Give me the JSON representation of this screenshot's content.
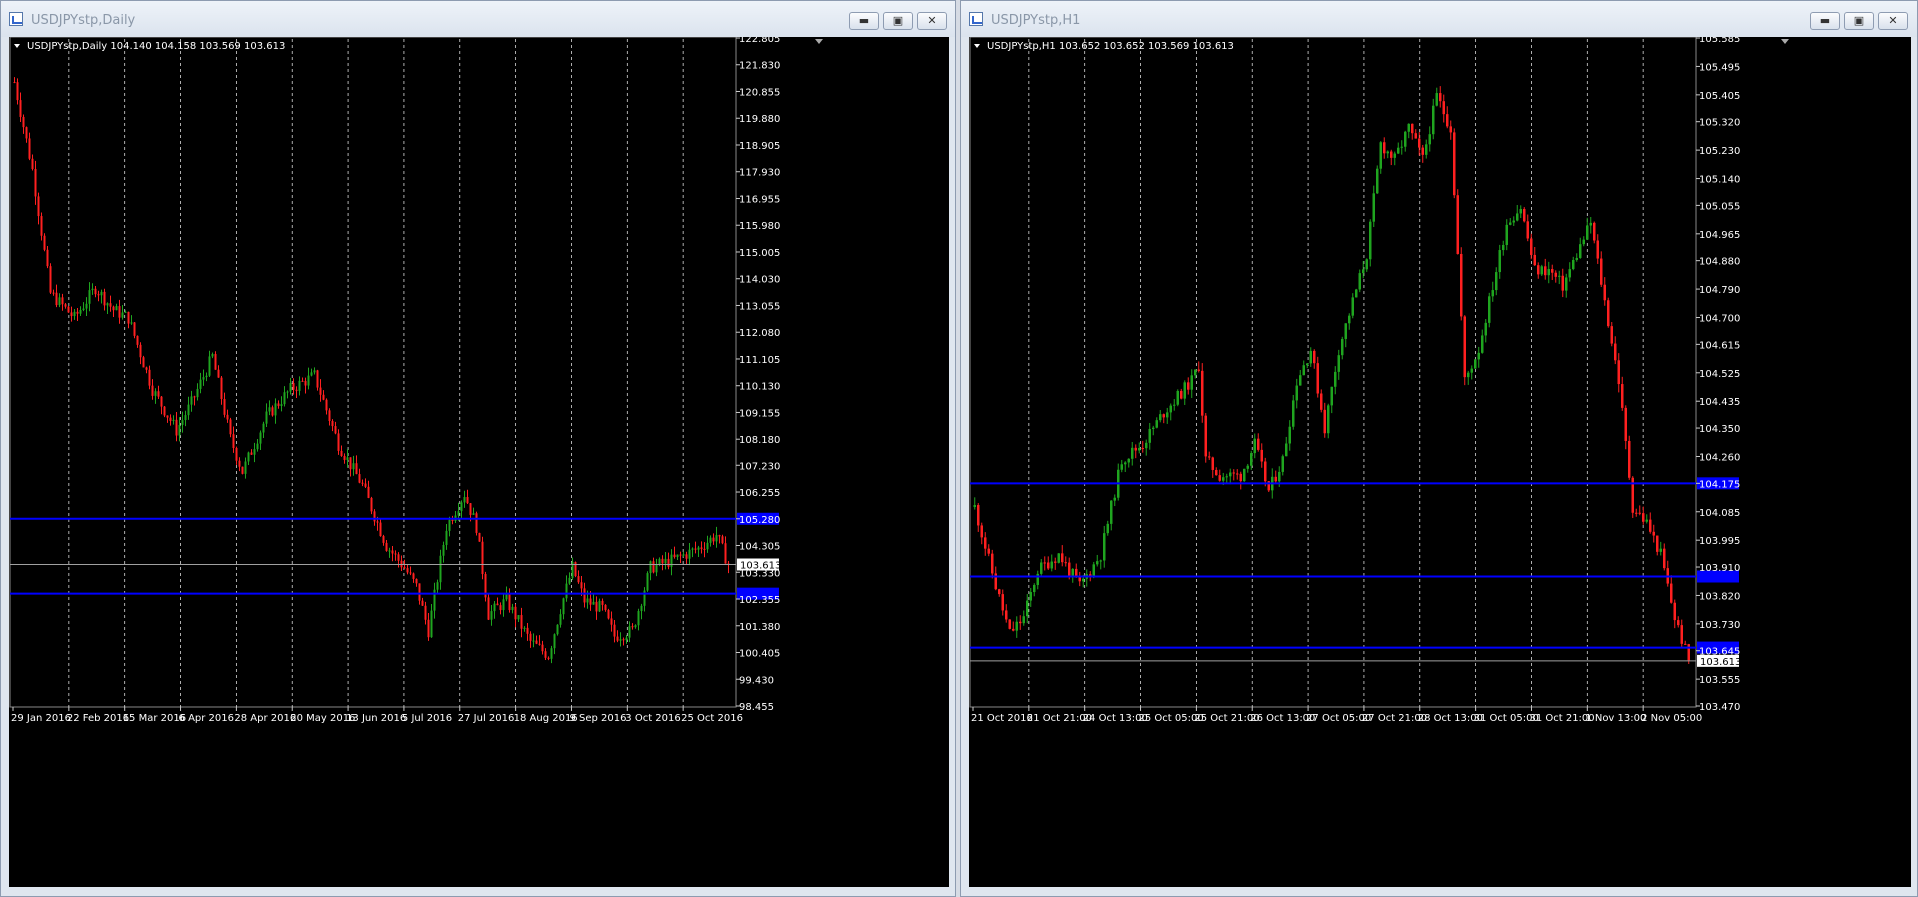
{
  "windows": [
    {
      "title": "USDJPYstp,Daily",
      "header": "USDJPYstp,Daily  104.140 104.158 103.569 103.613",
      "current_price": "103.613"
    },
    {
      "title": "USDJPYstp,H1",
      "header": "USDJPYstp,H1  103.652 103.652 103.569 103.613",
      "current_price": "103.613"
    }
  ],
  "colors": {
    "background": "#000000",
    "grid": "#ffffff",
    "bull_candle": "#1fa51f",
    "bear_candle": "#ff2020",
    "level_line": "#0000ff",
    "price_line": "#a0a0a0",
    "axis_text": "#ffffff"
  },
  "icons": [
    "chart-window-icon",
    "minimize-icon",
    "maximize-icon",
    "close-icon",
    "dropdown-triangle-icon"
  ],
  "chart_data": [
    {
      "type": "candlestick",
      "title": "USDJPYstp,Daily",
      "yticks": [
        "122.805",
        "121.830",
        "120.855",
        "119.880",
        "118.905",
        "117.930",
        "116.955",
        "115.980",
        "115.005",
        "114.030",
        "113.055",
        "112.080",
        "111.105",
        "110.130",
        "109.155",
        "108.180",
        "107.230",
        "106.255",
        "105.280",
        "104.305",
        "103.330",
        "102.355",
        "101.380",
        "100.405",
        "99.430",
        "98.455"
      ],
      "ylim": [
        98.455,
        122.805
      ],
      "xticks": [
        "29 Jan 2016",
        "22 Feb 2016",
        "15 Mar 2016",
        "6 Apr 2016",
        "28 Apr 2016",
        "20 May 2016",
        "13 Jun 2016",
        "5 Jul 2016",
        "27 Jul 2016",
        "18 Aug 2016",
        "9 Sep 2016",
        "3 Oct 2016",
        "25 Oct 2016"
      ],
      "levels": [
        105.28,
        102.55
      ],
      "current": 103.613,
      "current_label": "103.613",
      "anchors": [
        [
          0,
          121.2
        ],
        [
          6,
          118.0
        ],
        [
          12,
          113.5
        ],
        [
          20,
          112.6
        ],
        [
          27,
          113.7
        ],
        [
          33,
          112.9
        ],
        [
          38,
          112.6
        ],
        [
          46,
          110.0
        ],
        [
          54,
          108.5
        ],
        [
          59,
          109.5
        ],
        [
          66,
          111.2
        ],
        [
          72,
          108.2
        ],
        [
          76,
          107.0
        ],
        [
          84,
          109.0
        ],
        [
          92,
          110.0
        ],
        [
          100,
          110.5
        ],
        [
          108,
          108.0
        ],
        [
          116,
          106.5
        ],
        [
          124,
          104.3
        ],
        [
          130,
          103.5
        ],
        [
          134,
          102.8
        ],
        [
          138,
          101.2
        ],
        [
          144,
          105.0
        ],
        [
          150,
          106.2
        ],
        [
          154,
          105.0
        ],
        [
          158,
          101.8
        ],
        [
          164,
          102.3
        ],
        [
          172,
          100.8
        ],
        [
          178,
          100.3
        ],
        [
          182,
          102.0
        ],
        [
          186,
          103.5
        ],
        [
          190,
          102.3
        ],
        [
          196,
          102.0
        ],
        [
          200,
          101.0
        ],
        [
          206,
          101.2
        ],
        [
          212,
          103.5
        ],
        [
          220,
          103.8
        ],
        [
          228,
          104.2
        ],
        [
          234,
          104.7
        ],
        [
          238,
          103.613
        ]
      ]
    },
    {
      "type": "candlestick",
      "title": "USDJPYstp,H1",
      "yticks": [
        "105.585",
        "105.495",
        "105.405",
        "105.320",
        "105.230",
        "105.140",
        "105.055",
        "104.965",
        "104.880",
        "104.790",
        "104.700",
        "104.615",
        "104.525",
        "104.435",
        "104.350",
        "104.260",
        "104.175",
        "104.085",
        "103.995",
        "103.910",
        "103.820",
        "103.730",
        "103.645",
        "103.555",
        "103.470"
      ],
      "ylim": [
        103.47,
        105.585
      ],
      "xticks": [
        "21 Oct 2016",
        "21 Oct 21:00",
        "24 Oct 13:00",
        "25 Oct 05:00",
        "25 Oct 21:00",
        "26 Oct 13:00",
        "27 Oct 05:00",
        "27 Oct 21:00",
        "28 Oct 13:00",
        "31 Oct 05:00",
        "31 Oct 21:00",
        "1 Nov 13:00",
        "2 Nov 05:00"
      ],
      "levels": [
        104.175,
        103.88,
        103.655
      ],
      "current": 103.613,
      "current_label": "103.613",
      "anchors": [
        [
          0,
          104.1
        ],
        [
          6,
          103.85
        ],
        [
          10,
          103.7
        ],
        [
          14,
          103.75
        ],
        [
          18,
          103.9
        ],
        [
          24,
          103.95
        ],
        [
          30,
          103.85
        ],
        [
          36,
          103.95
        ],
        [
          42,
          104.25
        ],
        [
          48,
          104.3
        ],
        [
          54,
          104.4
        ],
        [
          58,
          104.45
        ],
        [
          62,
          104.5
        ],
        [
          64,
          104.55
        ],
        [
          66,
          104.25
        ],
        [
          70,
          104.2
        ],
        [
          76,
          104.2
        ],
        [
          80,
          104.3
        ],
        [
          84,
          104.15
        ],
        [
          88,
          104.25
        ],
        [
          92,
          104.5
        ],
        [
          96,
          104.6
        ],
        [
          100,
          104.35
        ],
        [
          104,
          104.6
        ],
        [
          108,
          104.75
        ],
        [
          112,
          104.9
        ],
        [
          116,
          105.25
        ],
        [
          120,
          105.2
        ],
        [
          124,
          105.3
        ],
        [
          128,
          105.2
        ],
        [
          132,
          105.4
        ],
        [
          136,
          105.3
        ],
        [
          140,
          104.5
        ],
        [
          144,
          104.6
        ],
        [
          148,
          104.8
        ],
        [
          152,
          105.0
        ],
        [
          156,
          105.05
        ],
        [
          160,
          104.85
        ],
        [
          164,
          104.85
        ],
        [
          168,
          104.8
        ],
        [
          172,
          104.9
        ],
        [
          176,
          105.0
        ],
        [
          180,
          104.75
        ],
        [
          184,
          104.5
        ],
        [
          188,
          104.1
        ],
        [
          192,
          104.05
        ],
        [
          196,
          103.95
        ],
        [
          200,
          103.75
        ],
        [
          204,
          103.613
        ]
      ]
    }
  ]
}
